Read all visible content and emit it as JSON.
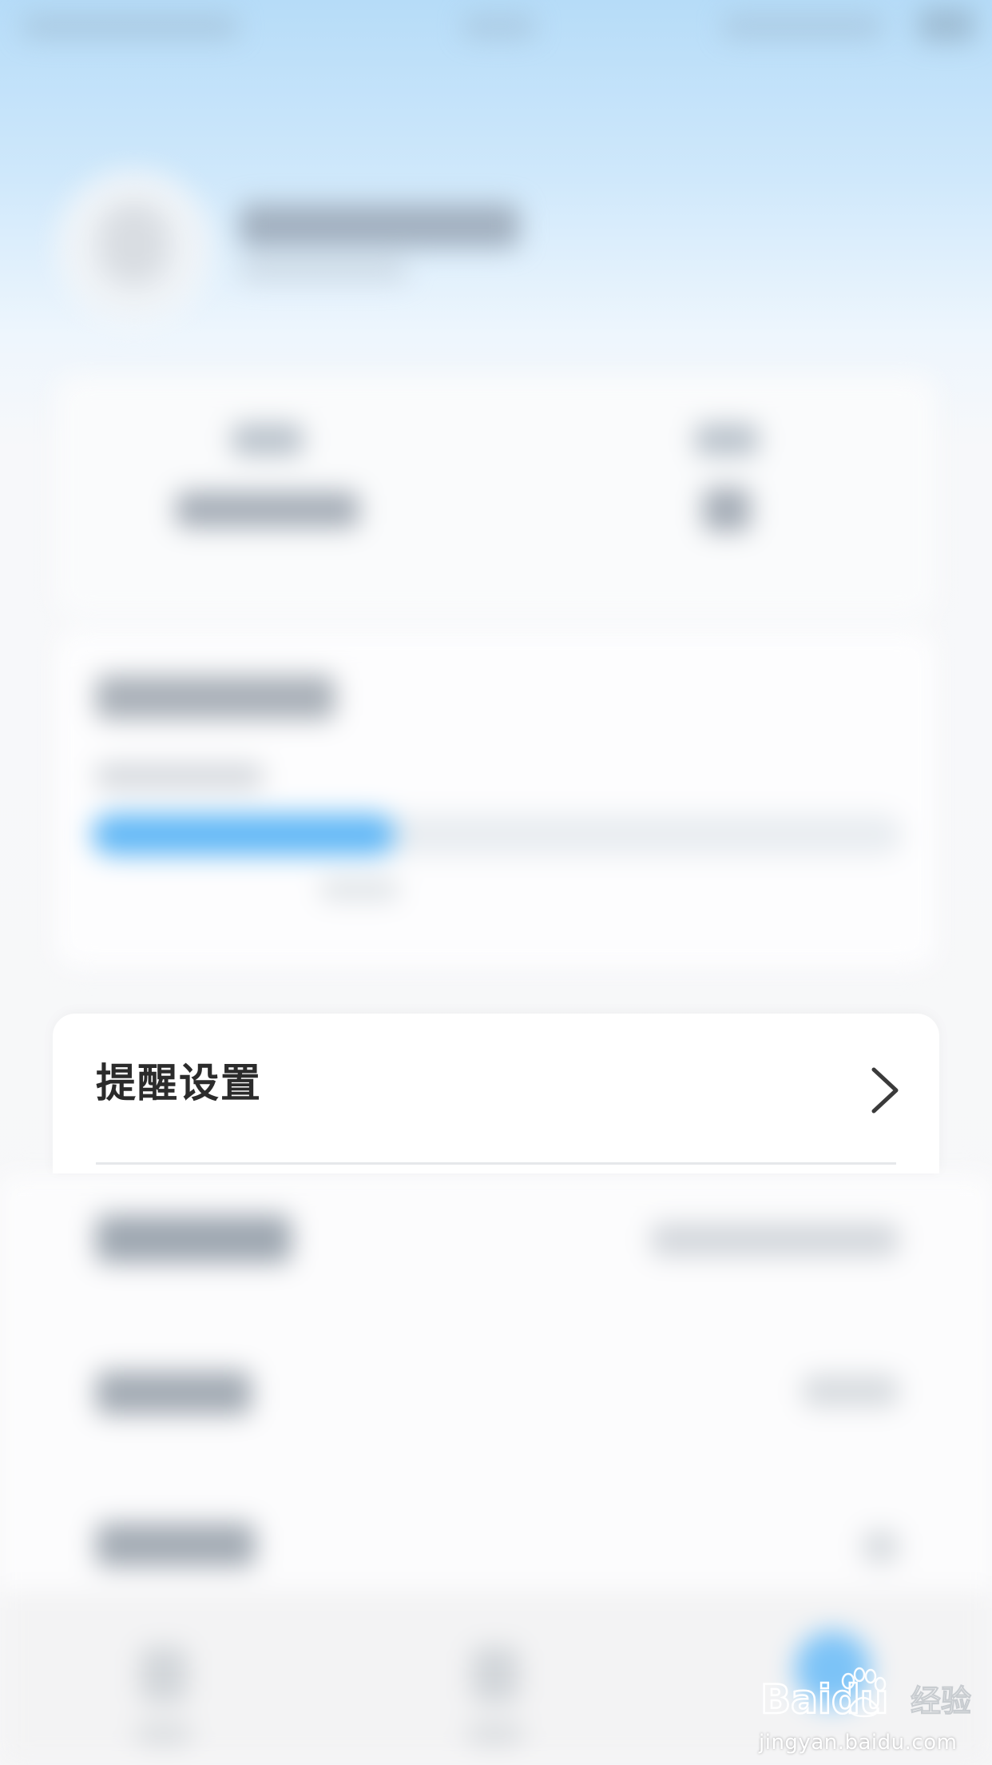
{
  "reminder_row": {
    "label": "提醒设置"
  },
  "watermark": {
    "brand": "Baidu",
    "suffix": "经验",
    "url": "jingyan.baidu.com"
  },
  "colors": {
    "accent": "#62b8f6",
    "header_gradient_top": "#b6dcf8",
    "text_dark": "#2b2b2b",
    "divider": "#e6e8eb"
  }
}
